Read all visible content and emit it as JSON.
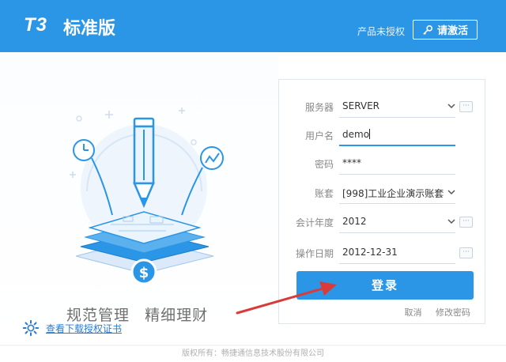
{
  "header": {
    "logo": "T3",
    "product": "标准版",
    "unauthorized": "产品未授权",
    "activate_label": "请激活"
  },
  "slogan": {
    "part1": "规范管理",
    "part2": "精细理财"
  },
  "cert_link": "查看下载授权证书",
  "footer": "版权所有：畅捷通信息技术股份有限公司",
  "form": {
    "server_label": "服务器",
    "server_value": "SERVER",
    "user_label": "用户名",
    "user_value": "demo",
    "password_label": "密码",
    "password_value": "****",
    "account_label": "账套",
    "account_value": "[998]工业企业演示账套",
    "year_label": "会计年度",
    "year_value": "2012",
    "date_label": "操作日期",
    "date_value": "2012-12-31",
    "more_glyph": "···",
    "login_label": "登录",
    "cancel_label": "取消",
    "change_password_label": "修改密码"
  },
  "colors": {
    "brand": "#2b95e6",
    "link": "#2b7bd4",
    "arrow": "#d93b3b"
  },
  "icons": [
    "key-icon",
    "chevron-down-icon",
    "gear-icon",
    "pencil-illustration"
  ]
}
